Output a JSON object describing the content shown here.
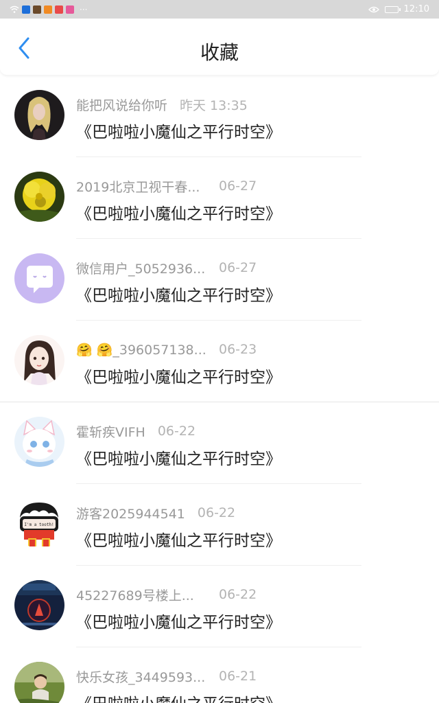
{
  "status_bar": {
    "time": "12:10",
    "dots": "···"
  },
  "header": {
    "title": "收藏",
    "back_icon": "chevron-left-icon"
  },
  "colors": {
    "accent": "#2f8ef0",
    "username": "#999999",
    "date": "#b3b3b3",
    "title": "#222222"
  },
  "items": [
    {
      "username": "能把风说给你听",
      "date": "昨天 13:35",
      "title": "《巴啦啦小魔仙之平行时空》"
    },
    {
      "username": "2019北京卫视干春...",
      "date": "06-27",
      "title": "《巴啦啦小魔仙之平行时空》"
    },
    {
      "username": "微信用户_5052936...",
      "date": "06-27",
      "title": "《巴啦啦小魔仙之平行时空》"
    },
    {
      "username": "🤗 🤗_396057138...",
      "date": "06-23",
      "title": "《巴啦啦小魔仙之平行时空》"
    },
    {
      "username": "霍斩疾VIFH",
      "date": "06-22",
      "title": "《巴啦啦小魔仙之平行时空》"
    },
    {
      "username": "游客2025944541",
      "date": "06-22",
      "title": "《巴啦啦小魔仙之平行时空》"
    },
    {
      "username": "45227689号楼上...",
      "date": "06-22",
      "title": "《巴啦啦小魔仙之平行时空》"
    },
    {
      "username": "快乐女孩_3449593...",
      "date": "06-21",
      "title": "《巴啦啦小魔仙之平行时空》"
    }
  ],
  "avatar_texts": {
    "shirt": "I'm a tooth!"
  }
}
